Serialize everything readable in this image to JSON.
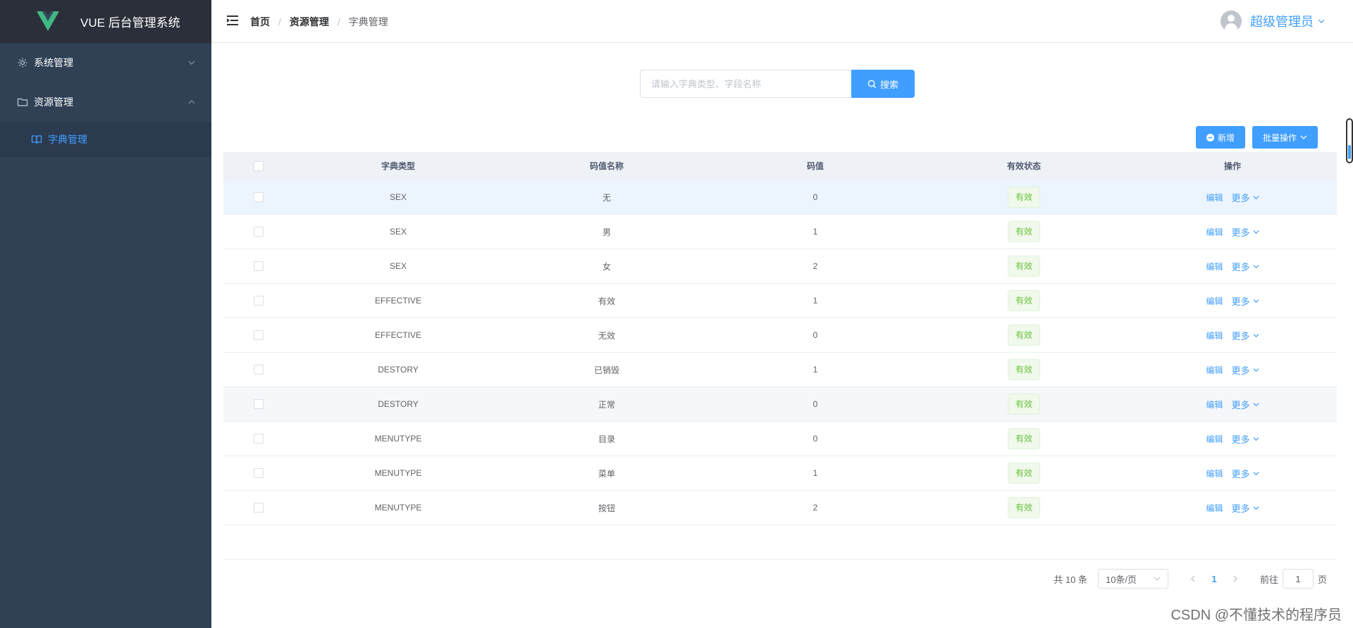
{
  "app": {
    "title": "VUE 后台管理系统"
  },
  "sidebar": {
    "items": [
      {
        "label": "系统管理",
        "icon": "gear-icon",
        "expanded": false
      },
      {
        "label": "资源管理",
        "icon": "folder-icon",
        "expanded": true
      }
    ],
    "subitems": [
      {
        "label": "字典管理",
        "icon": "book-icon",
        "active": true
      }
    ]
  },
  "header": {
    "breadcrumb": [
      "首页",
      "资源管理",
      "字典管理"
    ],
    "separator": "/",
    "user": {
      "name": "超级管理员"
    }
  },
  "search": {
    "placeholder": "请输入字典类型、字段名称",
    "value": "",
    "button_label": "搜索"
  },
  "toolbar": {
    "add_label": "新增",
    "batch_label": "批量操作"
  },
  "table": {
    "columns": [
      "字典类型",
      "码值名称",
      "码值",
      "有效状态",
      "操作"
    ],
    "rows": [
      {
        "type": "SEX",
        "name": "无",
        "code": "0",
        "status": "有效"
      },
      {
        "type": "SEX",
        "name": "男",
        "code": "1",
        "status": "有效"
      },
      {
        "type": "SEX",
        "name": "女",
        "code": "2",
        "status": "有效"
      },
      {
        "type": "EFFECTIVE",
        "name": "有效",
        "code": "1",
        "status": "有效"
      },
      {
        "type": "EFFECTIVE",
        "name": "无效",
        "code": "0",
        "status": "有效"
      },
      {
        "type": "DESTORY",
        "name": "已销毁",
        "code": "1",
        "status": "有效"
      },
      {
        "type": "DESTORY",
        "name": "正常",
        "code": "0",
        "status": "有效"
      },
      {
        "type": "MENUTYPE",
        "name": "目录",
        "code": "0",
        "status": "有效"
      },
      {
        "type": "MENUTYPE",
        "name": "菜单",
        "code": "1",
        "status": "有效"
      },
      {
        "type": "MENUTYPE",
        "name": "按钮",
        "code": "2",
        "status": "有效"
      }
    ],
    "edit_label": "编辑",
    "more_label": "更多"
  },
  "pagination": {
    "total_text": "共 10 条",
    "page_size_text": "10条/页",
    "current_page": "1",
    "jump_prefix": "前往",
    "jump_value": "1",
    "jump_suffix": "页"
  },
  "watermark": "CSDN @不懂技术的程序员",
  "colors": {
    "sidebar_bg": "#304156",
    "logo_bg": "#2b2f3a",
    "primary": "#409eff",
    "success": "#67c23a",
    "logo_green": "#41b883",
    "logo_dark": "#35495e"
  }
}
